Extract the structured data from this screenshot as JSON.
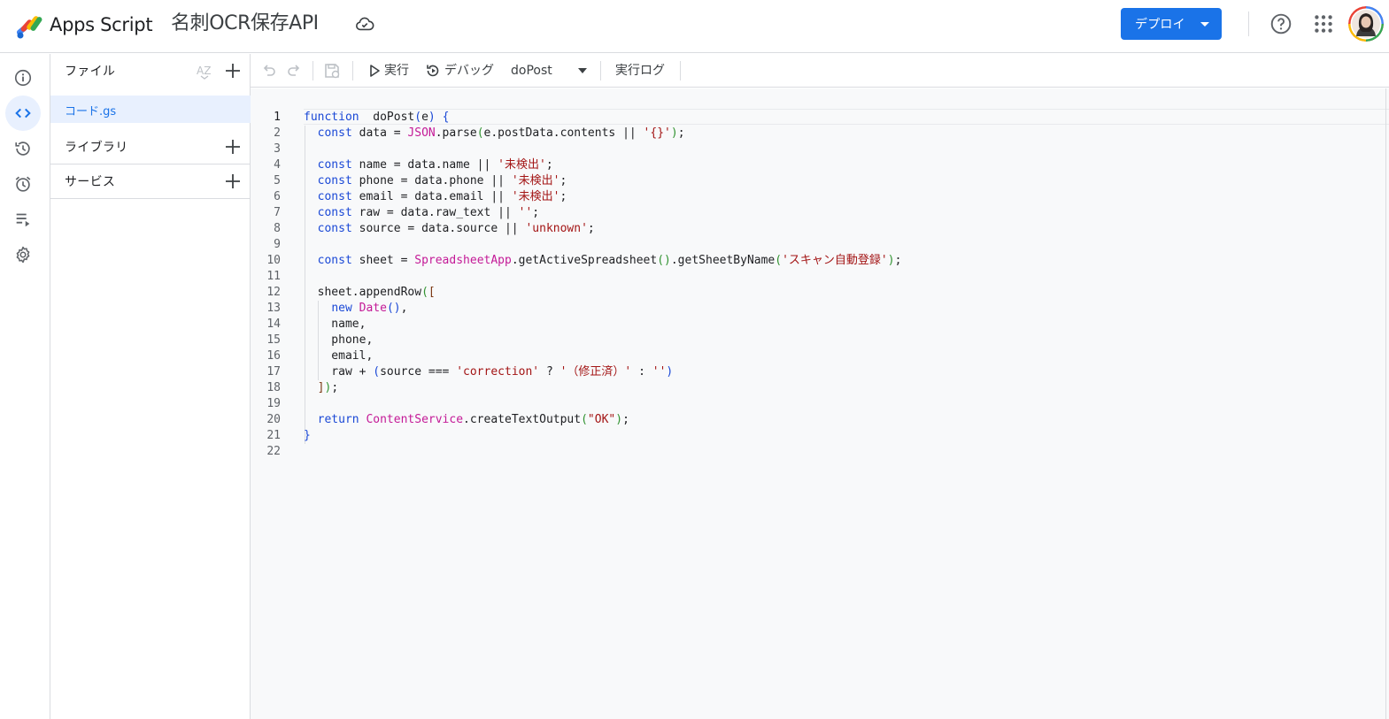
{
  "header": {
    "app_name": "Apps Script",
    "project_title": "名刺OCR保存API",
    "deploy_label": "デプロイ"
  },
  "rail": {
    "items": [
      "overview",
      "editor",
      "history",
      "triggers",
      "executions",
      "settings"
    ],
    "active": "editor"
  },
  "files_panel": {
    "files_label": "ファイル",
    "files": [
      {
        "name": "コード.gs",
        "selected": true
      }
    ],
    "libraries_label": "ライブラリ",
    "services_label": "サービス"
  },
  "toolbar": {
    "run_label": "実行",
    "debug_label": "デバッグ",
    "function_name": "doPost",
    "log_label": "実行ログ"
  },
  "editor": {
    "current_line": 1,
    "lines": [
      {
        "n": "1",
        "tokens": [
          [
            "kw",
            "function"
          ],
          [
            "",
            "  doPost"
          ],
          [
            "p1",
            "("
          ],
          [
            "",
            "e"
          ],
          [
            "p1",
            ")"
          ],
          [
            "",
            " "
          ],
          [
            "p1",
            "{"
          ]
        ]
      },
      {
        "n": "2",
        "tokens": [
          [
            "",
            "  "
          ],
          [
            "kw",
            "const"
          ],
          [
            "",
            " data = "
          ],
          [
            "cl",
            "JSON"
          ],
          [
            "",
            ".parse"
          ],
          [
            "p2",
            "("
          ],
          [
            "",
            "e.postData.contents || "
          ],
          [
            "str",
            "'{}'"
          ],
          [
            "p2",
            ")"
          ],
          [
            "",
            ";"
          ]
        ]
      },
      {
        "n": "3",
        "tokens": []
      },
      {
        "n": "4",
        "tokens": [
          [
            "",
            "  "
          ],
          [
            "kw",
            "const"
          ],
          [
            "",
            " name = data.name || "
          ],
          [
            "str",
            "'未検出'"
          ],
          [
            "",
            ";"
          ]
        ]
      },
      {
        "n": "5",
        "tokens": [
          [
            "",
            "  "
          ],
          [
            "kw",
            "const"
          ],
          [
            "",
            " phone = data.phone || "
          ],
          [
            "str",
            "'未検出'"
          ],
          [
            "",
            ";"
          ]
        ]
      },
      {
        "n": "6",
        "tokens": [
          [
            "",
            "  "
          ],
          [
            "kw",
            "const"
          ],
          [
            "",
            " email = data.email || "
          ],
          [
            "str",
            "'未検出'"
          ],
          [
            "",
            ";"
          ]
        ]
      },
      {
        "n": "7",
        "tokens": [
          [
            "",
            "  "
          ],
          [
            "kw",
            "const"
          ],
          [
            "",
            " raw = data.raw_text || "
          ],
          [
            "str",
            "''"
          ],
          [
            "",
            ";"
          ]
        ]
      },
      {
        "n": "8",
        "tokens": [
          [
            "",
            "  "
          ],
          [
            "kw",
            "const"
          ],
          [
            "",
            " source = data.source || "
          ],
          [
            "str",
            "'unknown'"
          ],
          [
            "",
            ";"
          ]
        ]
      },
      {
        "n": "9",
        "tokens": []
      },
      {
        "n": "10",
        "tokens": [
          [
            "",
            "  "
          ],
          [
            "kw",
            "const"
          ],
          [
            "",
            " sheet = "
          ],
          [
            "cl",
            "SpreadsheetApp"
          ],
          [
            "",
            ".getActiveSpreadsheet"
          ],
          [
            "p2",
            "()"
          ],
          [
            "",
            ".getSheetByName"
          ],
          [
            "p2",
            "("
          ],
          [
            "str",
            "'スキャン自動登録'"
          ],
          [
            "p2",
            ")"
          ],
          [
            "",
            ";"
          ]
        ]
      },
      {
        "n": "11",
        "tokens": []
      },
      {
        "n": "12",
        "tokens": [
          [
            "",
            "  sheet.appendRow"
          ],
          [
            "p2",
            "("
          ],
          [
            "p3",
            "["
          ]
        ]
      },
      {
        "n": "13",
        "tokens": [
          [
            "",
            "    "
          ],
          [
            "kw",
            "new"
          ],
          [
            "",
            " "
          ],
          [
            "cl",
            "Date"
          ],
          [
            "p1",
            "()"
          ],
          [
            "",
            ","
          ]
        ]
      },
      {
        "n": "14",
        "tokens": [
          [
            "",
            "    name,"
          ]
        ]
      },
      {
        "n": "15",
        "tokens": [
          [
            "",
            "    phone,"
          ]
        ]
      },
      {
        "n": "16",
        "tokens": [
          [
            "",
            "    email,"
          ]
        ]
      },
      {
        "n": "17",
        "tokens": [
          [
            "",
            "    raw + "
          ],
          [
            "p1",
            "("
          ],
          [
            "",
            "source === "
          ],
          [
            "str",
            "'correction'"
          ],
          [
            "",
            " ? "
          ],
          [
            "str",
            "'（修正済）'"
          ],
          [
            "",
            " : "
          ],
          [
            "str",
            "''"
          ],
          [
            "p1",
            ")"
          ]
        ]
      },
      {
        "n": "18",
        "tokens": [
          [
            "",
            "  "
          ],
          [
            "p3",
            "]"
          ],
          [
            "p2",
            ")"
          ],
          [
            "",
            ";"
          ]
        ]
      },
      {
        "n": "19",
        "tokens": []
      },
      {
        "n": "20",
        "tokens": [
          [
            "",
            "  "
          ],
          [
            "kw",
            "return"
          ],
          [
            "",
            " "
          ],
          [
            "cl",
            "ContentService"
          ],
          [
            "",
            ".createTextOutput"
          ],
          [
            "p2",
            "("
          ],
          [
            "str",
            "\"OK\""
          ],
          [
            "p2",
            ")"
          ],
          [
            "",
            ";"
          ]
        ]
      },
      {
        "n": "21",
        "tokens": [
          [
            "p1",
            "}"
          ]
        ]
      },
      {
        "n": "22",
        "tokens": []
      }
    ]
  },
  "colors": {
    "accent": "#1a73e8",
    "keyword": "#1a48d6",
    "class_name": "#c41a97",
    "string": "#a31515",
    "bracket_level_2": "#319331",
    "bracket_level_3": "#7b3814"
  }
}
